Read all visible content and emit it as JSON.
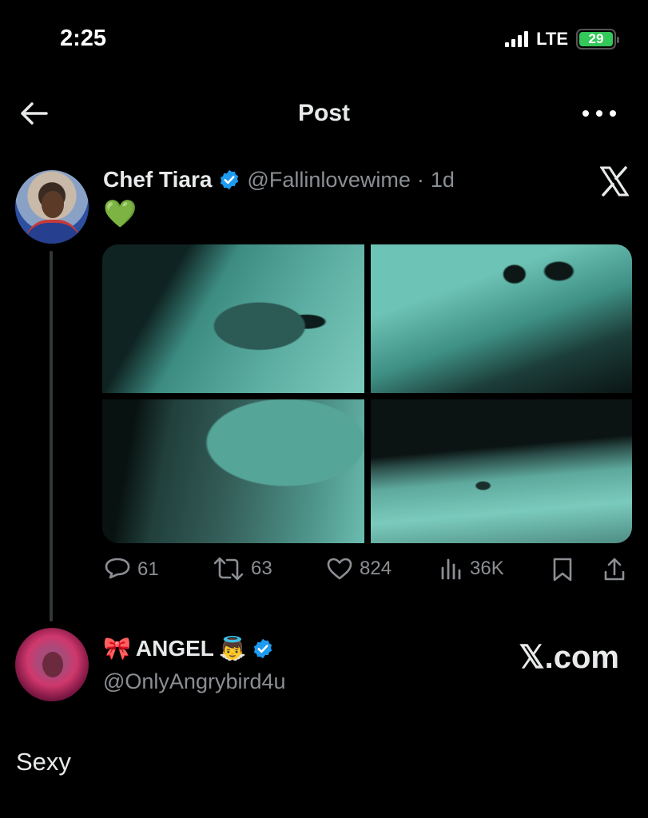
{
  "status_bar": {
    "time": "2:25",
    "network": "LTE",
    "battery": "29",
    "battery_color": "#34c759"
  },
  "nav": {
    "back_icon": "arrow-left-icon",
    "title": "Post",
    "more_icon": "more-horizontal-icon"
  },
  "tweet": {
    "author_name": "Chef Tiara",
    "verified": true,
    "handle": "@Fallinlovewime",
    "separator": "·",
    "age": "1d",
    "text": "💚",
    "media_count": 4,
    "stats": {
      "replies": "61",
      "reposts": "63",
      "likes": "824",
      "views": "36K"
    },
    "icons": [
      "reply-icon",
      "repost-icon",
      "like-icon",
      "views-icon",
      "bookmark-icon",
      "share-icon"
    ]
  },
  "reply": {
    "name_prefix_emoji": "🎀",
    "name": "ANGEL",
    "name_suffix_emoji": "👼",
    "verified": true,
    "handle": "@OnlyAngrybird4u",
    "text": "Sexy"
  },
  "watermark": "𝕏.com",
  "colors": {
    "background": "#000000",
    "text": "#e7e9ea",
    "muted": "#8b8f94",
    "verified_blue": "#1d9bf0",
    "thread_line": "#333639"
  }
}
